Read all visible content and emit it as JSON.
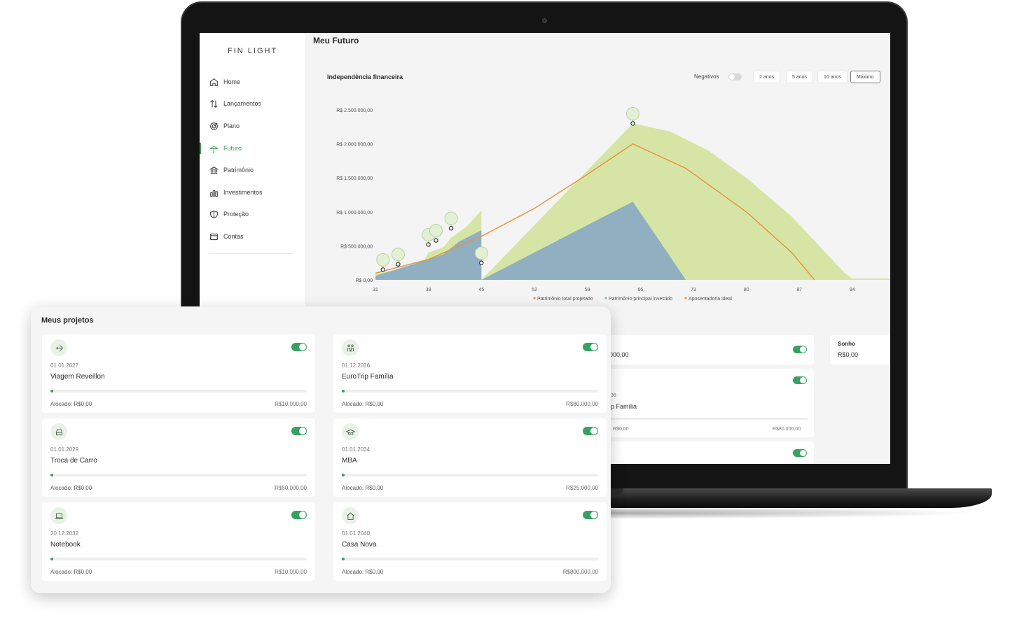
{
  "app": {
    "logo": "FIN LIGHT"
  },
  "sidebar": {
    "items": [
      {
        "label": "Home",
        "icon": "home-icon"
      },
      {
        "label": "Lançamentos",
        "icon": "arrows-updown-icon"
      },
      {
        "label": "Plano",
        "icon": "target-icon"
      },
      {
        "label": "Futuro",
        "icon": "umbrella-icon",
        "active": true
      },
      {
        "label": "Patrimônio",
        "icon": "bank-icon"
      },
      {
        "label": "Investimentos",
        "icon": "bar-chart-icon"
      },
      {
        "label": "Proteção",
        "icon": "shield-icon"
      },
      {
        "label": "Contas",
        "icon": "wallet-icon"
      }
    ]
  },
  "page": {
    "title": "Meu Futuro"
  },
  "chart_header": {
    "title": "Independência financeira",
    "negatives_label": "Negativos",
    "ranges": [
      "2 anos",
      "5 anos",
      "10 anos",
      "Máximo"
    ],
    "active_range": "Máximo"
  },
  "chart_data": {
    "type": "area",
    "title": "Independência financeira",
    "x_ticks": [
      "31",
      "38",
      "45",
      "52",
      "59",
      "66",
      "73",
      "80",
      "87",
      "94"
    ],
    "y_ticks": [
      "R$ 0,00",
      "R$ 500.000,00",
      "R$ 1.000.000,00",
      "R$ 1.500.000,00",
      "R$ 2.000.000,00",
      "R$ 2.500.000,00"
    ],
    "xlim": [
      31,
      99
    ],
    "ylim": [
      0,
      2500000
    ],
    "series": [
      {
        "name": "Patrimônio total projetado",
        "color": "#d6e5a6",
        "points": [
          [
            31,
            100000
          ],
          [
            37,
            200000
          ],
          [
            38,
            400000
          ],
          [
            40,
            480000
          ],
          [
            41,
            620000
          ],
          [
            43,
            780000
          ],
          [
            45,
            1020000
          ],
          [
            45,
            0
          ],
          [
            65,
            2300000
          ],
          [
            70,
            2180000
          ],
          [
            75,
            1900000
          ],
          [
            80,
            1500000
          ],
          [
            86,
            930000
          ],
          [
            93,
            100000
          ],
          [
            94,
            20000
          ],
          [
            99,
            20000
          ]
        ]
      },
      {
        "name": "Patrimônio principal investido",
        "color": "#90afc1",
        "points": [
          [
            31,
            60000
          ],
          [
            38,
            300000
          ],
          [
            40,
            380000
          ],
          [
            42,
            560000
          ],
          [
            45,
            730000
          ],
          [
            45,
            0
          ],
          [
            65,
            1150000
          ],
          [
            72,
            0
          ]
        ]
      },
      {
        "name": "Apoentadoria ideal",
        "color": "#e8953c",
        "points": [
          [
            31,
            100000
          ],
          [
            38,
            300000
          ],
          [
            45,
            640000
          ],
          [
            52,
            1050000
          ],
          [
            59,
            1550000
          ],
          [
            65,
            2000000
          ],
          [
            72,
            1640000
          ],
          [
            80,
            1000000
          ],
          [
            86,
            400000
          ],
          [
            89,
            0
          ]
        ]
      }
    ],
    "legend": [
      "Patrimônio total projetado",
      "Patrimônio principal investido",
      "Aposentadoria ideal"
    ],
    "legend_colors": [
      "#e8953c",
      "#90afc1",
      "#e8953c"
    ],
    "markers": [
      {
        "x": 32,
        "y": 150000,
        "icon": "plane-icon"
      },
      {
        "x": 34,
        "y": 230000,
        "icon": "car-icon"
      },
      {
        "x": 38,
        "y": 520000,
        "icon": "laptop-icon"
      },
      {
        "x": 39,
        "y": 580000,
        "icon": "graduation-cap-icon"
      },
      {
        "x": 41,
        "y": 760000,
        "icon": "family-icon"
      },
      {
        "x": 45,
        "y": 250000,
        "icon": "house-icon"
      },
      {
        "x": 65,
        "y": 2300000,
        "icon": "umbrella-icon"
      }
    ]
  },
  "background_cards": {
    "card1_value": "000,00",
    "sonho_label": "Sonho",
    "sonho_value": "R$0,00",
    "card2_date": "36",
    "card2_name": "p Família",
    "card2_alloc": "R$0,00",
    "card2_target": "R$80.000,00"
  },
  "projects_panel": {
    "title": "Meus projetos",
    "projects": [
      {
        "date": "01.01.2027",
        "name": "Viagem Reveillon",
        "alloc": "Alocado: R$0,00",
        "target": "R$10.000,00",
        "icon": "plane-icon",
        "progress": 0.01
      },
      {
        "date": "01.12.2036",
        "name": "EuroTrip Família",
        "alloc": "Alocado: R$0,00",
        "target": "R$80.000,00",
        "icon": "family-icon",
        "progress": 0.01
      },
      {
        "date": "01.01.2029",
        "name": "Troca de Carro",
        "alloc": "Alocado: R$0,00",
        "target": "R$50.000,00",
        "icon": "car-icon",
        "progress": 0.01
      },
      {
        "date": "01.01.2034",
        "name": "MBA",
        "alloc": "Alocado: R$0,00",
        "target": "R$25.000,00",
        "icon": "graduation-cap-icon",
        "progress": 0.01
      },
      {
        "date": "20.12.2032",
        "name": "Notebook",
        "alloc": "Alocado: R$0,00",
        "target": "R$10.000,00",
        "icon": "laptop-icon",
        "progress": 0.01
      },
      {
        "date": "01.01.2040",
        "name": "Casa Nova",
        "alloc": "Alocado: R$0,00",
        "target": "R$800.000,00",
        "icon": "house-icon",
        "progress": 0.01
      }
    ]
  }
}
